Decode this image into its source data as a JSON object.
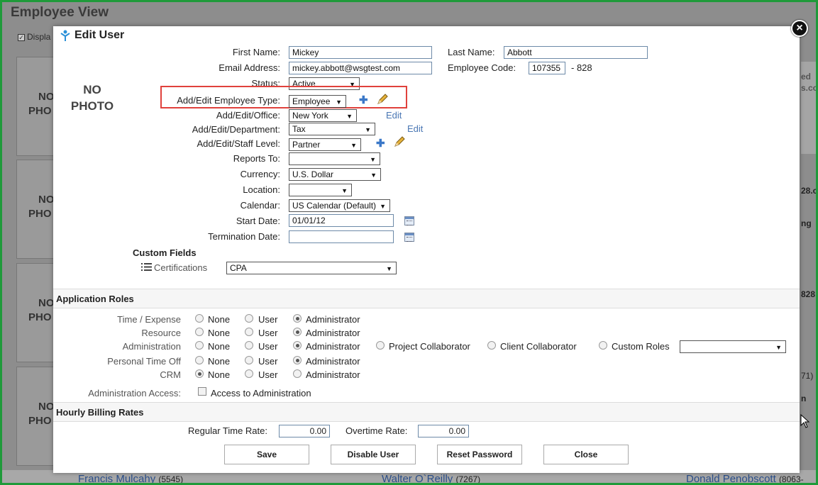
{
  "background": {
    "page_title": "Employee View",
    "display_label": "Displa",
    "no_photo_card": [
      "NO",
      "PHO"
    ],
    "right_fragments": [
      "ed",
      "s.co",
      "28.c",
      "ng",
      "828",
      "71)",
      "n"
    ],
    "bottom_employees": [
      {
        "name": "Francis Mulcahy",
        "code": "(5545)"
      },
      {
        "name": "Walter O`Reilly",
        "code": "(7267)"
      },
      {
        "name": "Donald Penobscott",
        "code": "(8063-"
      }
    ]
  },
  "modal": {
    "title": "Edit User",
    "no_photo_line1": "NO",
    "no_photo_line2": "PHOTO",
    "fields": {
      "first_name_label": "First Name:",
      "first_name": "Mickey",
      "last_name_label": "Last Name:",
      "last_name": "Abbott",
      "email_label": "Email Address:",
      "email": "mickey.abbott@wsgtest.com",
      "employee_code_label": "Employee Code:",
      "employee_code": "107355",
      "employee_code_suffix": "- 828",
      "status_label": "Status:",
      "status": "Active",
      "employee_type_label": "Add/Edit Employee Type:",
      "employee_type": "Employee",
      "office_label": "Add/Edit/Office:",
      "office": "New York",
      "office_edit": "Edit",
      "department_label": "Add/Edit/Department:",
      "department": "Tax",
      "department_edit": "Edit",
      "staff_level_label": "Add/Edit/Staff Level:",
      "staff_level": "Partner",
      "reports_to_label": "Reports To:",
      "reports_to": "",
      "currency_label": "Currency:",
      "currency": "U.S. Dollar",
      "location_label": "Location:",
      "location": "",
      "calendar_label": "Calendar:",
      "calendar": "US Calendar (Default)",
      "start_date_label": "Start Date:",
      "start_date": "01/01/12",
      "termination_date_label": "Termination Date:",
      "termination_date": ""
    },
    "custom_fields": {
      "heading": "Custom Fields",
      "certifications_label": "Certifications",
      "certifications": "CPA"
    },
    "application_roles": {
      "heading": "Application Roles",
      "options": {
        "none": "None",
        "user": "User",
        "administrator": "Administrator"
      },
      "rows": [
        {
          "label": "Time / Expense",
          "selected": "administrator"
        },
        {
          "label": "Resource",
          "selected": "administrator"
        },
        {
          "label": "Administration",
          "selected": "administrator"
        },
        {
          "label": "Personal Time Off",
          "selected": "administrator"
        },
        {
          "label": "CRM",
          "selected": "none"
        }
      ],
      "extra_roles": {
        "project_collaborator": "Project Collaborator",
        "client_collaborator": "Client Collaborator",
        "custom_roles": "Custom Roles",
        "custom_roles_value": ""
      },
      "admin_access_label": "Administration Access:",
      "admin_access_checkbox": "Access to Administration"
    },
    "billing": {
      "heading": "Hourly Billing Rates",
      "regular_label": "Regular Time Rate:",
      "regular": "0.00",
      "overtime_label": "Overtime Rate:",
      "overtime": "0.00"
    },
    "buttons": {
      "save": "Save",
      "disable": "Disable User",
      "reset": "Reset Password",
      "close": "Close"
    }
  },
  "colors": {
    "frame": "#1f9a3a",
    "highlight": "#e0413c",
    "link": "#4a77b4"
  }
}
